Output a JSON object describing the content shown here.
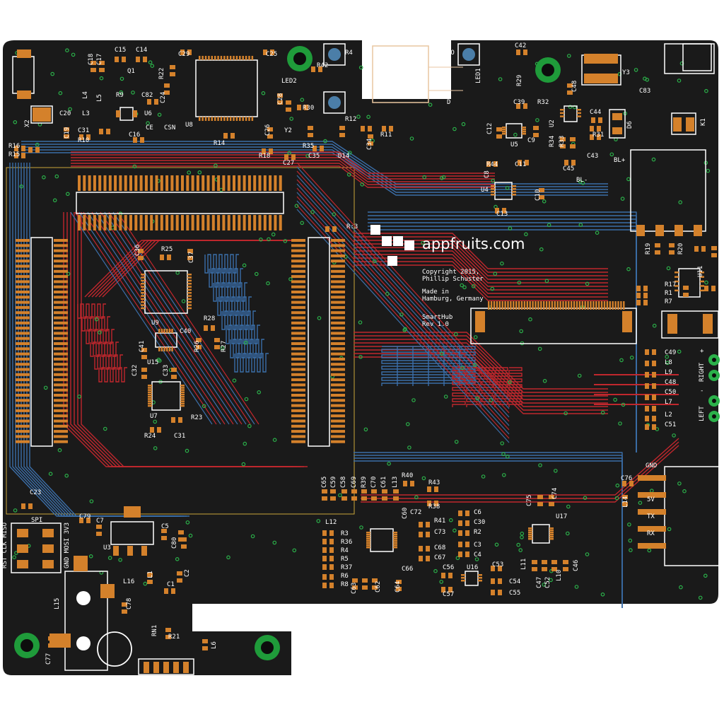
{
  "colors": {
    "board": "#1a1a1a",
    "copper_top": "#c0272d",
    "copper_bottom": "#3b6ea8",
    "pad": "#d4812b",
    "silkscreen": "#ffffff",
    "via": "#2bb14a",
    "mount_hole": "#1f9b3a"
  },
  "branding": {
    "site": "appfruits.com",
    "copyright": "Copyright 2015,",
    "author": "Phillip Schuster",
    "made_in": "Made in",
    "location": "Hamburg, Germany",
    "product": "SmartHub",
    "revision": "Rev 1.0"
  },
  "markers": {
    "bl_plus": "BL+",
    "bl_minus": "BL-",
    "right": "RIGHT",
    "left": "LEFT",
    "plus": "+",
    "minus": "-",
    "gnd": "GND",
    "v5": "5V",
    "tx": "TX",
    "rx": "RX",
    "spi": "SPI",
    "spi_pins_left": "RST CLK MISO",
    "spi_pins_right": "GND MOSI 3V3"
  },
  "labels": {
    "C15": "C15",
    "C14": "C14",
    "C18": "C18",
    "C17": "C17",
    "Q1": "Q1",
    "R22": "R22",
    "C29": "C29",
    "C25": "C25",
    "R42": "R42",
    "R41": "R4",
    "LED2": "LED2",
    "C28": "C28",
    "R30": "R30",
    "C42": "C42",
    "R29": "R29",
    "LED1": "LED1",
    "C39": "C39",
    "Y3": "Y3",
    "C83": "C83",
    "C48t": "C48",
    "R32": "R32",
    "C44": "C44",
    "D6": "D6",
    "K1": "K1",
    "X2": "X2",
    "C20": "C20",
    "C19": "C19",
    "L3": "L3",
    "L4": "L4",
    "L5": "L5",
    "R9": "R9",
    "C82": "C82",
    "C24": "C24",
    "U6": "U6",
    "U8": "U8",
    "C31": "C31",
    "R10": "R10",
    "C16": "C16",
    "CE": "CE",
    "CSN": "CSN",
    "C26": "C26",
    "Y2": "Y2",
    "R14": "R14",
    "R18": "R18",
    "C27": "C27",
    "R35": "R35",
    "C35": "C35",
    "D14": "D14",
    "R12": "R12",
    "C34": "C34",
    "R11": "R11",
    "C12": "C12",
    "U5": "U5",
    "C9": "C9",
    "C11": "C11",
    "R34": "R34",
    "R33": "R33",
    "U2": "U2",
    "R31": "R31",
    "C43": "C43",
    "C45": "C45",
    "R16": "R16",
    "R15": "R15",
    "R44": "R44",
    "C8": "C8",
    "U4": "U4",
    "C10": "C10",
    "C13": "C13",
    "R3t": "R:3",
    "C36": "C36",
    "R25": "R25",
    "C37": "C37",
    "U9": "U9",
    "R28": "R28",
    "C40": "C40",
    "C41": "C41",
    "R26": "R26",
    "R27": "R27",
    "U15": "U15",
    "C32": "C32",
    "C33": "C33",
    "U7": "U7",
    "R23": "R23",
    "R24": "R24",
    "C31b": "C31",
    "R19": "R19",
    "R20": "R20",
    "C21": "C21",
    "U11": "U11",
    "R17": "R17",
    "R1": "R1",
    "R7": "R7",
    "C49": "C49",
    "L8": "L8",
    "L9": "L9",
    "C48": "C48",
    "C50": "C50",
    "L7": "L7",
    "L2": "L2",
    "C51": "C51",
    "C23": "C23",
    "C79": "C79",
    "C7": "C7",
    "U3": "U3",
    "C5": "C5",
    "C80": "C80",
    "L16": "L16",
    "L1": "L1",
    "C2": "C2",
    "C1": "C1",
    "L15": "L15",
    "C78": "C78",
    "C77": "C77",
    "RN1": "RN1",
    "R21": "R21",
    "L6": "L6",
    "C65": "C65",
    "C59": "C59",
    "C58": "C58",
    "C69": "C69",
    "R39": "R39",
    "C70": "C70",
    "C61": "C61",
    "L13": "L13",
    "R40": "R40",
    "R43": "R43",
    "R38": "R38",
    "C72": "C72",
    "C60": "C60",
    "L12": "L12",
    "R3": "R3",
    "R36": "R36",
    "R4": "R4",
    "R5": "R5",
    "R37": "R37",
    "R6": "R6",
    "R8": "R8",
    "C63": "C63",
    "C62": "C62",
    "C64": "C64",
    "C66": "C66",
    "R41b": "R41",
    "C73": "C73",
    "C68": "C68",
    "C67": "C67",
    "C6": "C6",
    "C30": "C30",
    "R2": "R2",
    "C3": "C3",
    "C4": "C4",
    "C56": "C56",
    "U16": "U16",
    "C57": "C57",
    "C53": "C53",
    "C54": "C54",
    "C55": "C55",
    "C75": "C75",
    "C74": "C74",
    "U17": "U17",
    "C76": "C76",
    "L14": "L14",
    "L11": "L11",
    "C47": "C47",
    "C52": "C52",
    "L10": "L10",
    "C46": "C46",
    "IO": "IO",
    "D": "D"
  }
}
